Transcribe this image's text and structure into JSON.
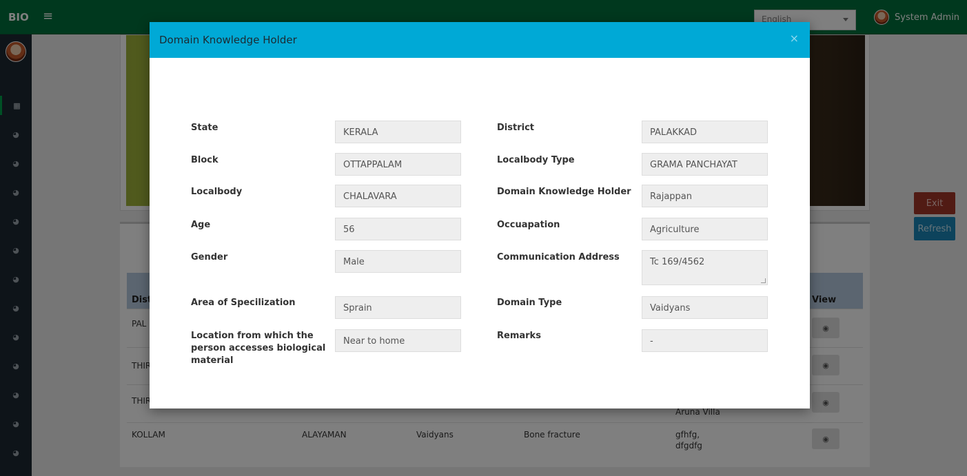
{
  "topbar": {
    "brand": "BIO",
    "menu_icon": "hamburger-icon",
    "language_select": {
      "selected": "English"
    },
    "user": {
      "name": "System Admin",
      "icon": "avatar"
    }
  },
  "sidebar": {
    "icons": [
      "grid-icon",
      "dashboard-icon",
      "dashboard-icon",
      "dashboard-icon",
      "dashboard-icon",
      "dashboard-icon",
      "dashboard-icon",
      "dashboard-icon",
      "dashboard-icon",
      "dashboard-icon",
      "dashboard-icon",
      "dashboard-icon",
      "dashboard-icon"
    ]
  },
  "page": {
    "buttons": {
      "exit": "Exit",
      "refresh": "Refresh"
    },
    "table": {
      "headers": {
        "district": "Dist",
        "view": "View"
      },
      "rows": [
        {
          "district": "PAL",
          "local": "",
          "domain": "",
          "specialization": "",
          "address_lines": [
            ""
          ]
        },
        {
          "district": "THIR",
          "local": "",
          "domain": "",
          "specialization": "",
          "address_lines": [
            ""
          ]
        },
        {
          "district": "THIR",
          "local": "",
          "domain": "",
          "specialization": "",
          "address_lines": [
            "Aruna Villa"
          ]
        },
        {
          "district": "KOLLAM",
          "local": "ALAYAMAN",
          "domain": "Vaidyans",
          "specialization": "Bone fracture",
          "address_lines": [
            "gfhfg,",
            "dfgdfg"
          ]
        }
      ]
    }
  },
  "modal": {
    "title": "Domain Knowledge Holder",
    "close": "×",
    "fields": {
      "state": {
        "label": "State",
        "value": "KERALA"
      },
      "district": {
        "label": "District",
        "value": "PALAKKAD"
      },
      "block": {
        "label": "Block",
        "value": "OTTAPPALAM"
      },
      "localbody_type": {
        "label": "Localbody Type",
        "value": "GRAMA PANCHAYAT"
      },
      "localbody": {
        "label": "Localbody",
        "value": "CHALAVARA"
      },
      "holder": {
        "label": "Domain Knowledge Holder",
        "value": "Rajappan"
      },
      "age": {
        "label": "Age",
        "value": "56"
      },
      "occupation": {
        "label": "Occuapation",
        "value": "Agriculture"
      },
      "gender": {
        "label": "Gender",
        "value": "Male"
      },
      "address": {
        "label": "Communication Address",
        "value": "Tc 169/4562"
      },
      "specialization": {
        "label": "Area of Specilization",
        "value": "Sprain"
      },
      "domain_type": {
        "label": "Domain Type",
        "value": "Vaidyans"
      },
      "location": {
        "label": "Location from which the person accesses biological material",
        "value": "Near to home"
      },
      "remarks": {
        "label": "Remarks",
        "value": "-"
      }
    }
  },
  "colors": {
    "topbar": "#00703c",
    "sidebar": "#1c2833",
    "modal_header": "#00a9d6",
    "exit": "#a33628",
    "refresh": "#1a86b8"
  }
}
